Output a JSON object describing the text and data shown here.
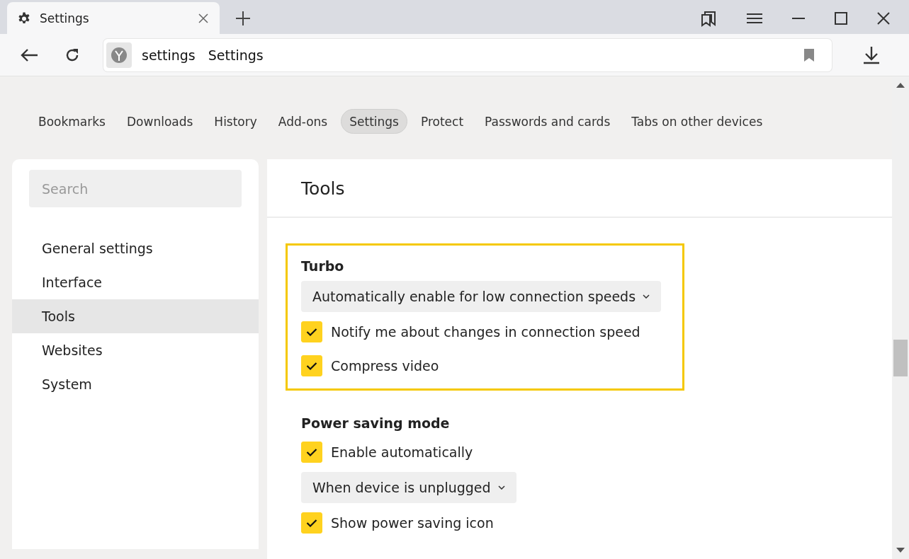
{
  "tab": {
    "title": "Settings"
  },
  "address": {
    "host": "settings",
    "title": "Settings"
  },
  "nav": [
    {
      "label": "Bookmarks",
      "selected": false
    },
    {
      "label": "Downloads",
      "selected": false
    },
    {
      "label": "History",
      "selected": false
    },
    {
      "label": "Add-ons",
      "selected": false
    },
    {
      "label": "Settings",
      "selected": true
    },
    {
      "label": "Protect",
      "selected": false
    },
    {
      "label": "Passwords and cards",
      "selected": false
    },
    {
      "label": "Tabs on other devices",
      "selected": false
    }
  ],
  "sidebar": {
    "search": {
      "placeholder": "Search"
    },
    "items": [
      {
        "label": "General settings",
        "selected": false
      },
      {
        "label": "Interface",
        "selected": false
      },
      {
        "label": "Tools",
        "selected": true
      },
      {
        "label": "Websites",
        "selected": false
      },
      {
        "label": "System",
        "selected": false
      }
    ]
  },
  "panel": {
    "title": "Tools",
    "sections": [
      {
        "title": "Turbo",
        "highlighted": true,
        "items": [
          {
            "kind": "dropdown",
            "label": "Automatically enable for low connection speeds"
          },
          {
            "kind": "checkbox",
            "label": "Notify me about changes in connection speed",
            "checked": true
          },
          {
            "kind": "checkbox",
            "label": "Compress video",
            "checked": true
          }
        ]
      },
      {
        "title": "Power saving mode",
        "highlighted": false,
        "items": [
          {
            "kind": "checkbox",
            "label": "Enable automatically",
            "checked": true
          },
          {
            "kind": "dropdown",
            "label": "When device is unplugged"
          },
          {
            "kind": "checkbox",
            "label": "Show power saving icon",
            "checked": true
          }
        ]
      }
    ]
  }
}
